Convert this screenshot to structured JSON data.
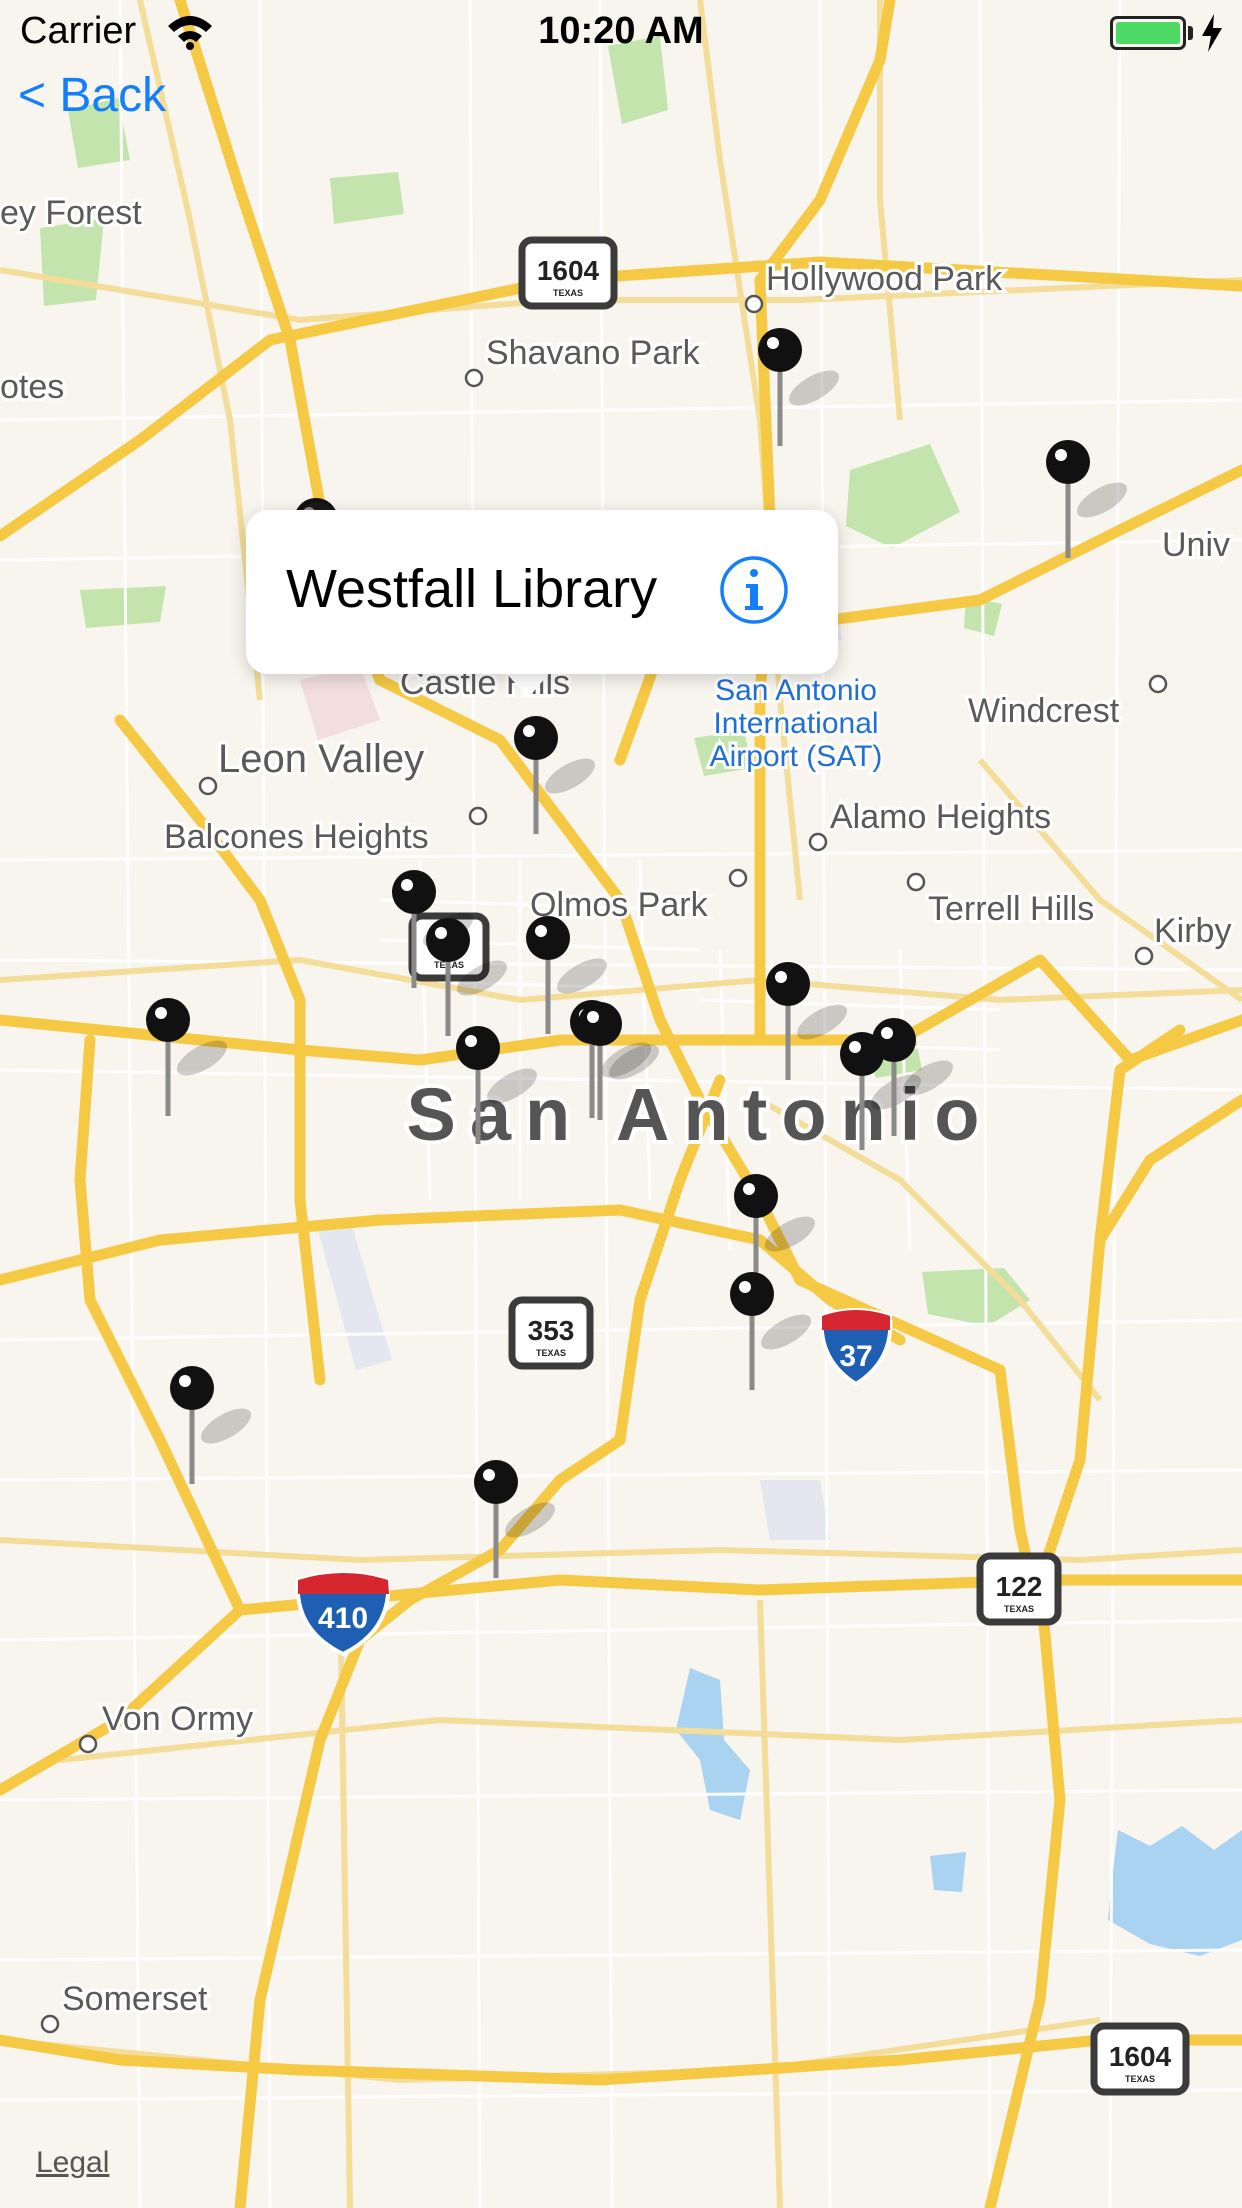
{
  "status_bar": {
    "carrier": "Carrier",
    "time": "10:20 AM",
    "battery_level": 1.0
  },
  "nav": {
    "back_label": "< Back"
  },
  "callout": {
    "title": "Westfall Library"
  },
  "map": {
    "legal_label": "Legal",
    "city_label": "San Antonio",
    "places": [
      "ey Forest",
      "otes",
      "Hollywood Park",
      "Shavano Park",
      "Univ",
      "Castle Hills",
      "Leon Valley",
      "Windcrest",
      "Balcones Heights",
      "Alamo Heights",
      "Olmos Park",
      "Terrell Hills",
      "Kirby",
      "Von Ormy",
      "Somerset"
    ],
    "airport_label": [
      "San Antonio",
      "International",
      "Airport (SAT)"
    ],
    "shields": [
      {
        "number": "1604",
        "state": "TEXAS",
        "kind": "state"
      },
      {
        "number": "353",
        "state": "TEXAS",
        "kind": "state"
      },
      {
        "number": "122",
        "state": "TEXAS",
        "kind": "state"
      },
      {
        "number": "1604",
        "state": "TEXAS",
        "kind": "state"
      },
      {
        "number": "37",
        "kind": "interstate"
      },
      {
        "number": "410",
        "kind": "interstate"
      }
    ],
    "pin_count": 20,
    "colors": {
      "land": "#f8f4ee",
      "highway": "#f7cf4b",
      "park": "#bfe2a8",
      "water": "#a9d3f0",
      "accent": "#147efb"
    }
  }
}
